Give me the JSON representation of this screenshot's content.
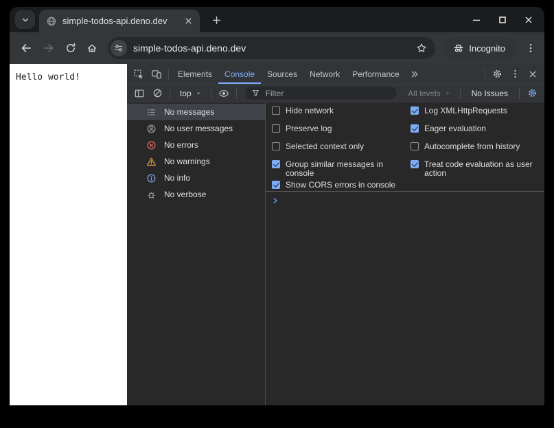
{
  "browser": {
    "tab_title": "simple-todos-api.deno.dev",
    "url": "simple-todos-api.deno.dev",
    "incognito_label": "Incognito"
  },
  "page": {
    "body_text": "Hello world!"
  },
  "devtools": {
    "tabs": [
      "Elements",
      "Console",
      "Sources",
      "Network",
      "Performance"
    ],
    "active_tab": "Console",
    "toolbar": {
      "context": "top",
      "filter_placeholder": "Filter",
      "levels": "All levels",
      "issues": "No Issues"
    },
    "sidebar": {
      "items": [
        {
          "label": "No messages",
          "icon": "list-icon",
          "selected": true
        },
        {
          "label": "No user messages",
          "icon": "user-icon",
          "selected": false
        },
        {
          "label": "No errors",
          "icon": "error-icon",
          "selected": false
        },
        {
          "label": "No warnings",
          "icon": "warning-icon",
          "selected": false
        },
        {
          "label": "No info",
          "icon": "info-icon",
          "selected": false
        },
        {
          "label": "No verbose",
          "icon": "bug-icon",
          "selected": false
        }
      ]
    },
    "settings": {
      "left": [
        {
          "label": "Hide network",
          "checked": false
        },
        {
          "label": "Preserve log",
          "checked": false
        },
        {
          "label": "Selected context only",
          "checked": false
        },
        {
          "label": "Group similar messages in console",
          "checked": true
        },
        {
          "label": "Show CORS errors in console",
          "checked": true
        }
      ],
      "right": [
        {
          "label": "Log XMLHttpRequests",
          "checked": true
        },
        {
          "label": "Eager evaluation",
          "checked": true
        },
        {
          "label": "Autocomplete from history",
          "checked": false
        },
        {
          "label": "Treat code evaluation as user action",
          "checked": true
        }
      ]
    },
    "colors": {
      "accent": "#7cacf8"
    }
  }
}
